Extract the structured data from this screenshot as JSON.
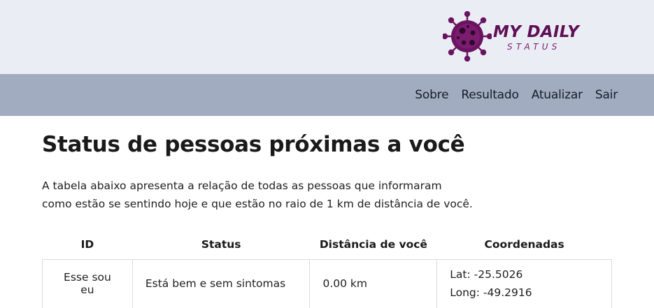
{
  "brand": {
    "title": "MY DAILY",
    "subtitle": "STATUS",
    "accent_color": "#5e0f55",
    "icon": "virus-icon"
  },
  "nav": {
    "items": [
      "Sobre",
      "Resultado",
      "Atualizar",
      "Sair"
    ]
  },
  "main": {
    "title": "Status de pessoas próximas a você",
    "intro_line1": "A tabela abaixo apresenta a relação de todas as pessoas que informaram",
    "intro_line2": "como estão se sentindo hoje e que estão no raio de 1 km de distância de você."
  },
  "table": {
    "headers": [
      "ID",
      "Status",
      "Distância de você",
      "Coordenadas"
    ],
    "rows": [
      {
        "id": "Esse sou eu",
        "status": "Está bem e sem sintomas",
        "distance": "0.00 km",
        "lat": "Lat: -25.5026",
        "long": "Long: -49.2916"
      }
    ]
  }
}
